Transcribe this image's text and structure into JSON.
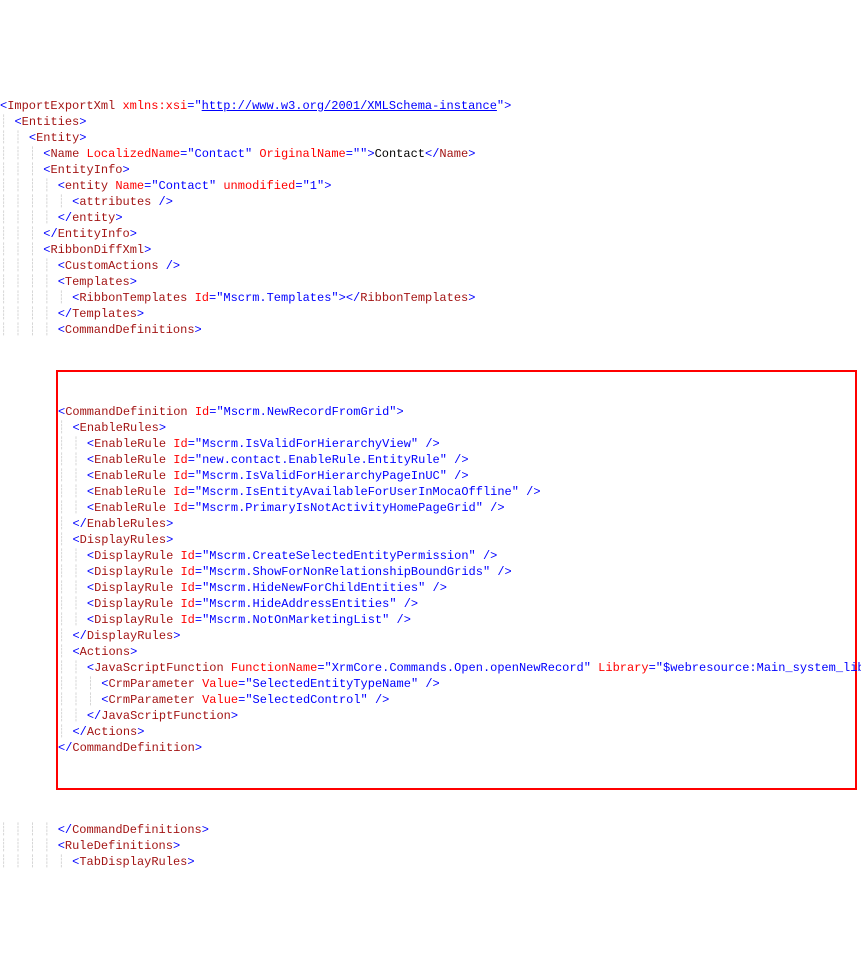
{
  "lines": [
    {
      "indent": 0,
      "type": "open-tag-attr",
      "tag": "ImportExportXml",
      "attrs": [
        {
          "name": "xmlns:xsi",
          "value": "http://www.w3.org/2001/XMLSchema-instance",
          "link": true
        }
      ],
      "close": false
    },
    {
      "indent": 1,
      "type": "open-tag",
      "tag": "Entities"
    },
    {
      "indent": 2,
      "type": "open-tag",
      "tag": "Entity"
    },
    {
      "indent": 3,
      "type": "full-tag",
      "tag": "Name",
      "attrs": [
        {
          "name": "LocalizedName",
          "value": "Contact"
        },
        {
          "name": "OriginalName",
          "value": ""
        }
      ],
      "text": "Contact"
    },
    {
      "indent": 3,
      "type": "open-tag",
      "tag": "EntityInfo"
    },
    {
      "indent": 4,
      "type": "open-tag-attr",
      "tag": "entity",
      "attrs": [
        {
          "name": "Name",
          "value": "Contact"
        },
        {
          "name": "unmodified",
          "value": "1"
        }
      ],
      "close": false
    },
    {
      "indent": 5,
      "type": "self-close",
      "tag": "attributes"
    },
    {
      "indent": 4,
      "type": "close-tag",
      "tag": "entity"
    },
    {
      "indent": 3,
      "type": "close-tag",
      "tag": "EntityInfo"
    },
    {
      "indent": 3,
      "type": "open-tag",
      "tag": "RibbonDiffXml"
    },
    {
      "indent": 4,
      "type": "self-close",
      "tag": "CustomActions"
    },
    {
      "indent": 4,
      "type": "open-tag",
      "tag": "Templates"
    },
    {
      "indent": 5,
      "type": "full-tag",
      "tag": "RibbonTemplates",
      "attrs": [
        {
          "name": "Id",
          "value": "Mscrm.Templates"
        }
      ],
      "text": ""
    },
    {
      "indent": 4,
      "type": "close-tag",
      "tag": "Templates"
    },
    {
      "indent": 4,
      "type": "open-tag",
      "tag": "CommandDefinitions"
    }
  ],
  "highlighted_lines": [
    {
      "indent": 5,
      "type": "open-tag-attr",
      "tag": "CommandDefinition",
      "attrs": [
        {
          "name": "Id",
          "value": "Mscrm.NewRecordFromGrid"
        }
      ],
      "close": false
    },
    {
      "indent": 6,
      "type": "open-tag",
      "tag": "EnableRules"
    },
    {
      "indent": 7,
      "type": "self-close-attr",
      "tag": "EnableRule",
      "attrs": [
        {
          "name": "Id",
          "value": "Mscrm.IsValidForHierarchyView"
        }
      ]
    },
    {
      "indent": 7,
      "type": "self-close-attr",
      "tag": "EnableRule",
      "attrs": [
        {
          "name": "Id",
          "value": "new.contact.EnableRule.EntityRule"
        }
      ]
    },
    {
      "indent": 7,
      "type": "self-close-attr",
      "tag": "EnableRule",
      "attrs": [
        {
          "name": "Id",
          "value": "Mscrm.IsValidForHierarchyPageInUC"
        }
      ]
    },
    {
      "indent": 7,
      "type": "self-close-attr",
      "tag": "EnableRule",
      "attrs": [
        {
          "name": "Id",
          "value": "Mscrm.IsEntityAvailableForUserInMocaOffline"
        }
      ]
    },
    {
      "indent": 7,
      "type": "self-close-attr",
      "tag": "EnableRule",
      "attrs": [
        {
          "name": "Id",
          "value": "Mscrm.PrimaryIsNotActivityHomePageGrid"
        }
      ]
    },
    {
      "indent": 6,
      "type": "close-tag",
      "tag": "EnableRules"
    },
    {
      "indent": 6,
      "type": "open-tag",
      "tag": "DisplayRules"
    },
    {
      "indent": 7,
      "type": "self-close-attr",
      "tag": "DisplayRule",
      "attrs": [
        {
          "name": "Id",
          "value": "Mscrm.CreateSelectedEntityPermission"
        }
      ]
    },
    {
      "indent": 7,
      "type": "self-close-attr",
      "tag": "DisplayRule",
      "attrs": [
        {
          "name": "Id",
          "value": "Mscrm.ShowForNonRelationshipBoundGrids"
        }
      ]
    },
    {
      "indent": 7,
      "type": "self-close-attr",
      "tag": "DisplayRule",
      "attrs": [
        {
          "name": "Id",
          "value": "Mscrm.HideNewForChildEntities"
        }
      ]
    },
    {
      "indent": 7,
      "type": "self-close-attr",
      "tag": "DisplayRule",
      "attrs": [
        {
          "name": "Id",
          "value": "Mscrm.HideAddressEntities"
        }
      ]
    },
    {
      "indent": 7,
      "type": "self-close-attr",
      "tag": "DisplayRule",
      "attrs": [
        {
          "name": "Id",
          "value": "Mscrm.NotOnMarketingList"
        }
      ]
    },
    {
      "indent": 6,
      "type": "close-tag",
      "tag": "DisplayRules"
    },
    {
      "indent": 6,
      "type": "open-tag",
      "tag": "Actions"
    },
    {
      "indent": 7,
      "type": "open-tag-attr",
      "tag": "JavaScriptFunction",
      "attrs": [
        {
          "name": "FunctionName",
          "value": "XrmCore.Commands.Open.openNewRecord"
        },
        {
          "name": "Library",
          "value": "$webresource:Main_system_library.js"
        }
      ],
      "close": false
    },
    {
      "indent": 8,
      "type": "self-close-attr",
      "tag": "CrmParameter",
      "attrs": [
        {
          "name": "Value",
          "value": "SelectedEntityTypeName"
        }
      ]
    },
    {
      "indent": 8,
      "type": "self-close-attr",
      "tag": "CrmParameter",
      "attrs": [
        {
          "name": "Value",
          "value": "SelectedControl"
        }
      ]
    },
    {
      "indent": 7,
      "type": "close-tag",
      "tag": "JavaScriptFunction"
    },
    {
      "indent": 6,
      "type": "close-tag",
      "tag": "Actions"
    },
    {
      "indent": 5,
      "type": "close-tag",
      "tag": "CommandDefinition"
    }
  ],
  "lines_after": [
    {
      "indent": 4,
      "type": "close-tag",
      "tag": "CommandDefinitions"
    },
    {
      "indent": 4,
      "type": "open-tag",
      "tag": "RuleDefinitions"
    },
    {
      "indent": 5,
      "type": "open-tag",
      "tag": "TabDisplayRules"
    }
  ]
}
